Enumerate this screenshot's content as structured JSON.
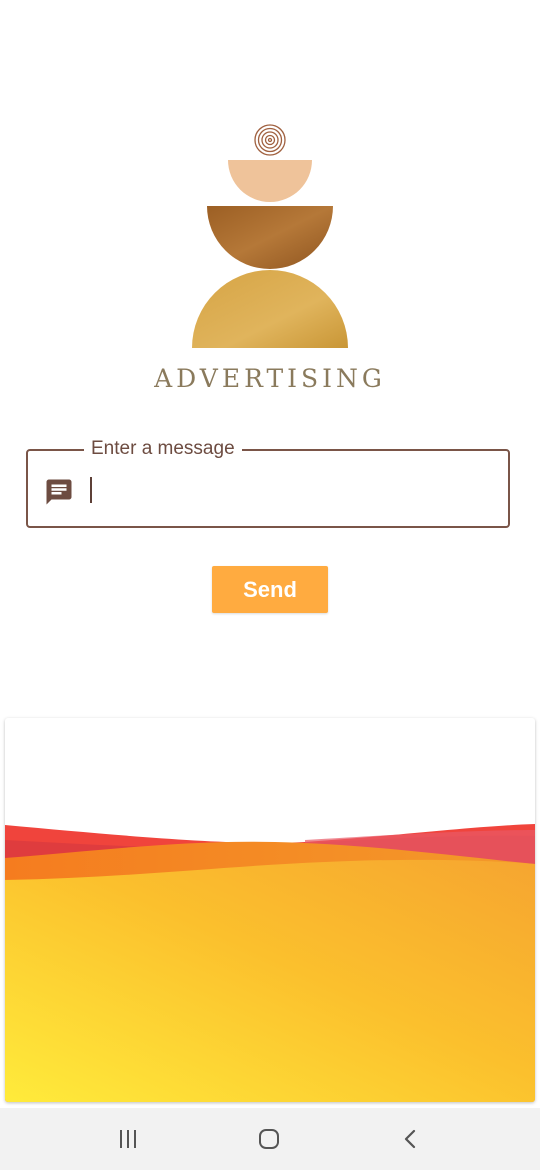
{
  "brand": {
    "name": "ADVERTISING",
    "logo_icon": "stacked-semicircles-logo",
    "colors": {
      "swirl": "#a0603f",
      "top_bowl": "#efc39a",
      "middle_bowl": "#a66a2c",
      "bottom_dome": "#d9a94a",
      "text": "#8a7a5c"
    }
  },
  "message_field": {
    "label": "Enter a message",
    "value": "",
    "icon": "message-icon",
    "border_color": "#7a5548"
  },
  "send_button": {
    "label": "Send",
    "color": "#ffab40"
  },
  "banner": {
    "wave_colors": [
      "#f0443c",
      "#f57c1f",
      "#fdd835",
      "#f9a825"
    ]
  },
  "nav_bar": {
    "recents_icon": "recents-icon",
    "home_icon": "home-icon",
    "back_icon": "back-icon"
  }
}
